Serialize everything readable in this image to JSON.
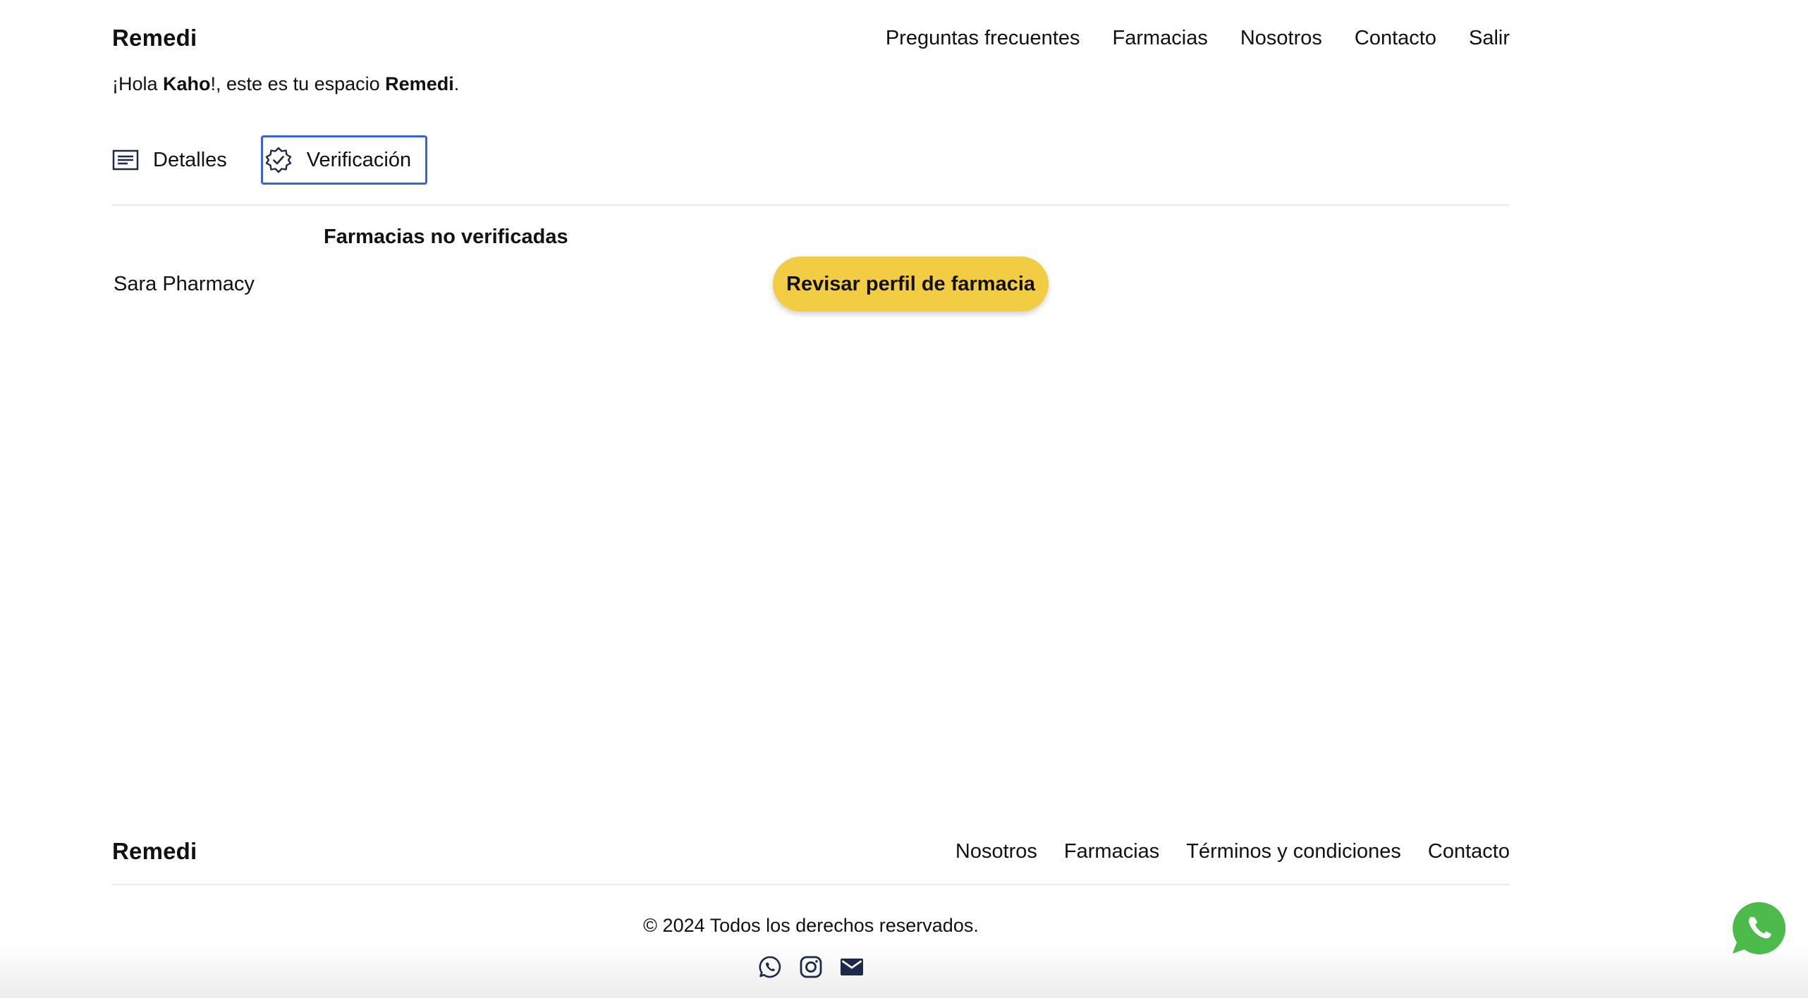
{
  "header": {
    "logo": "Remedi",
    "nav": [
      "Preguntas frecuentes",
      "Farmacias",
      "Nosotros",
      "Contacto",
      "Salir"
    ]
  },
  "greeting": {
    "prefix": "¡Hola ",
    "name": "Kaho",
    "middle": "!, este es tu espacio ",
    "brand": "Remedi",
    "suffix": "."
  },
  "tabs": [
    {
      "label": "Detalles",
      "icon": "details-icon",
      "active": false
    },
    {
      "label": "Verificación",
      "icon": "verified-badge-icon",
      "active": true
    }
  ],
  "verification": {
    "title": "Farmacias no verificadas",
    "pharmacies": [
      {
        "name": "Sara Pharmacy",
        "action": "Revisar perfil de farmacia"
      }
    ]
  },
  "footer": {
    "logo": "Remedi",
    "nav": [
      "Nosotros",
      "Farmacias",
      "Términos y condiciones",
      "Contacto"
    ],
    "copyright": "© 2024 Todos los derechos reservados.",
    "socials": [
      "whatsapp-icon",
      "instagram-icon",
      "mail-icon"
    ]
  },
  "colors": {
    "accent_button": "#f2cd44",
    "active_tab_border": "#3a63d6",
    "whatsapp_green": "#4cbb4b",
    "social_icon": "#1c2a4a"
  }
}
